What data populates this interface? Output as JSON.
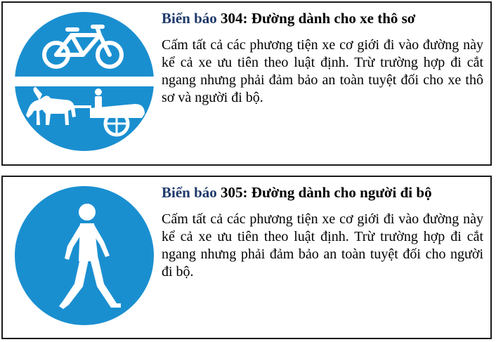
{
  "sign_304": {
    "title_lead": "Biển báo",
    "title_rest": "304: Đường dành cho xe thô sơ",
    "description": "Cấm tất cả các phương tiện xe cơ giới đi vào đường này kể cả xe ưu tiên theo luật định. Trừ trường hợp đi cắt ngang nhưng phải đảm bảo an toàn tuyệt đối cho xe thô sơ và người đi bộ.",
    "icon": "bicycle-horse-cart-sign-icon",
    "color": "#1a8fd0"
  },
  "sign_305": {
    "title_lead": "Biển báo",
    "title_rest": "305: Đường dành cho người đi bộ",
    "description": "Cấm tất cả các phương tiện xe cơ giới đi vào đường này kể cả xe ưu tiên theo luật định. Trừ trường hợp đi cắt ngang nhưng phải đảm bảo an toàn tuyệt đối cho người đi bộ.",
    "icon": "pedestrian-sign-icon",
    "color": "#1a8fd0"
  }
}
